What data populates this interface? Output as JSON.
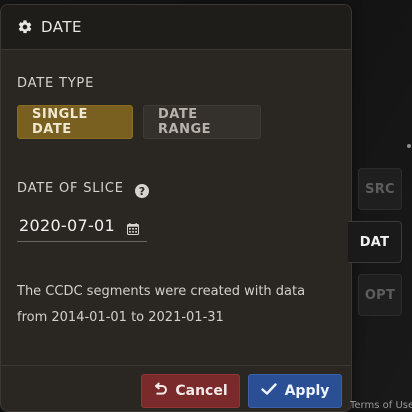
{
  "panel": {
    "title": "DATE",
    "title_icon": "gear-icon",
    "date_type_label": "DATE TYPE",
    "date_type_buttons": [
      {
        "label": "SINGLE DATE",
        "selected": true
      },
      {
        "label": "DATE RANGE",
        "selected": false
      }
    ],
    "date_of_slice_label": "DATE OF SLICE",
    "help_icon": "question-circle-icon",
    "date_value": "2020-07-01",
    "calendar_icon": "calendar-icon",
    "info_text_line1": "The CCDC segments were created with data",
    "info_text_line2": "from 2014-01-01 to 2021-01-31",
    "cancel_label": "Cancel",
    "apply_label": "Apply"
  },
  "side_tabs": [
    {
      "label": "SRC",
      "active": false
    },
    {
      "label": "DAT",
      "active": true
    },
    {
      "label": "OPT",
      "active": false
    }
  ],
  "bottom_strip_text": "Terms of Use",
  "colors": {
    "panel_bg": "#2a2722",
    "header_bg": "#1f1d1a",
    "single_date_bg": "#7a6020",
    "cancel_bg": "#7a2a2a",
    "apply_bg": "#2b4f95"
  }
}
